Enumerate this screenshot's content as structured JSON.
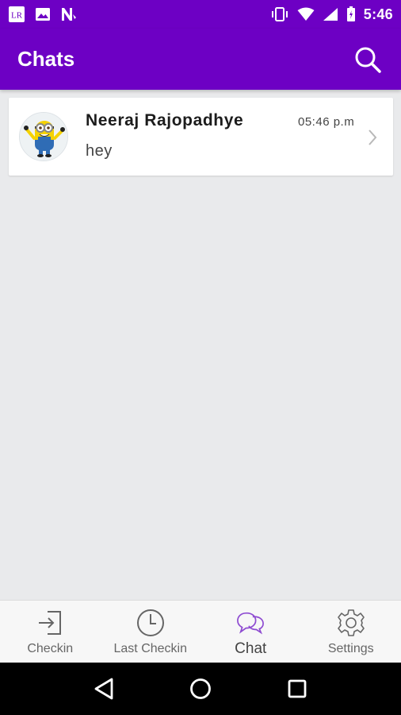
{
  "status_bar": {
    "app_badge": "LR",
    "time": "5:46"
  },
  "app_bar": {
    "title": "Chats"
  },
  "chats": [
    {
      "name": "Neeraj Rajopadhye",
      "time": "05:46 p.m",
      "message": "hey",
      "avatar_icon": "minion-avatar"
    }
  ],
  "bottom_nav": {
    "items": [
      {
        "label": "Checkin",
        "icon": "checkin-icon"
      },
      {
        "label": "Last Checkin",
        "icon": "clock-icon"
      },
      {
        "label": "Chat",
        "icon": "chat-bubbles-icon",
        "active": true
      },
      {
        "label": "Settings",
        "icon": "gear-icon"
      }
    ]
  },
  "colors": {
    "primary": "#6d00c4",
    "background": "#e9eaec",
    "active_icon": "#8e4bd1"
  }
}
